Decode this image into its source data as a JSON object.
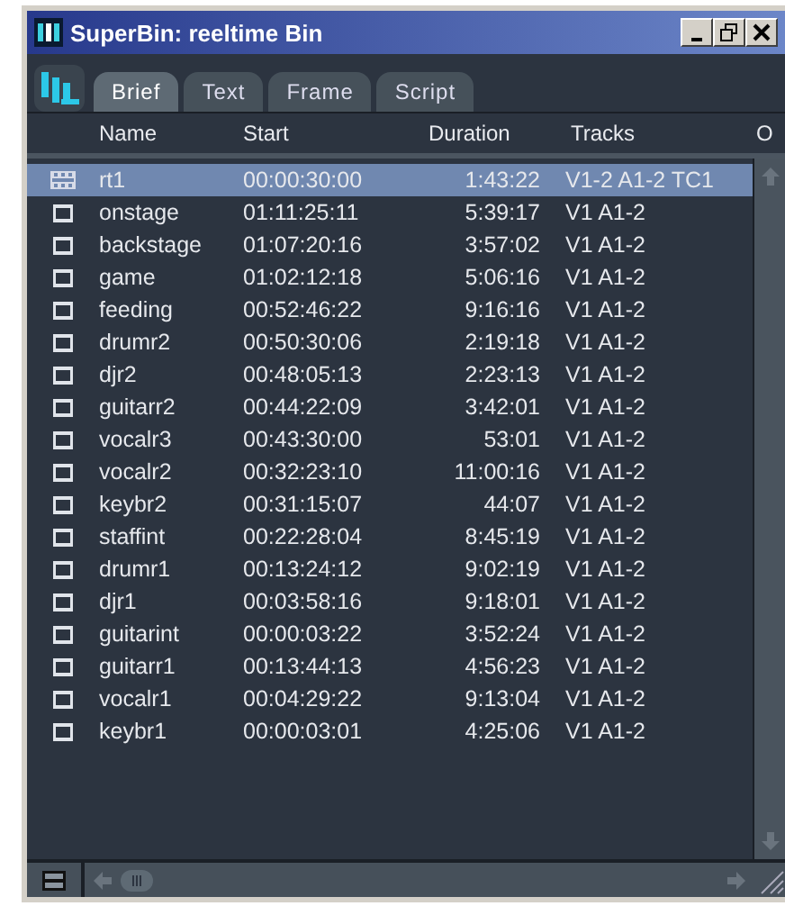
{
  "window": {
    "title": "SuperBin: reeltime Bin"
  },
  "tabs": [
    {
      "label": "Brief",
      "selected": true
    },
    {
      "label": "Text",
      "selected": false
    },
    {
      "label": "Frame",
      "selected": false
    },
    {
      "label": "Script",
      "selected": false
    }
  ],
  "columns": [
    "Name",
    "Start",
    "Duration",
    "Tracks",
    "O"
  ],
  "rows": [
    {
      "kind": "sequence",
      "selected": true,
      "name": "rt1",
      "start": "00:00:30:00",
      "duration": "1:43:22",
      "tracks": "V1-2 A1-2 TC1"
    },
    {
      "kind": "clip",
      "selected": false,
      "name": "onstage",
      "start": "01:11:25:11",
      "duration": "5:39:17",
      "tracks": "V1 A1-2"
    },
    {
      "kind": "clip",
      "selected": false,
      "name": "backstage",
      "start": "01:07:20:16",
      "duration": "3:57:02",
      "tracks": "V1 A1-2"
    },
    {
      "kind": "clip",
      "selected": false,
      "name": "game",
      "start": "01:02:12:18",
      "duration": "5:06:16",
      "tracks": "V1 A1-2"
    },
    {
      "kind": "clip",
      "selected": false,
      "name": "feeding",
      "start": "00:52:46:22",
      "duration": "9:16:16",
      "tracks": "V1 A1-2"
    },
    {
      "kind": "clip",
      "selected": false,
      "name": "drumr2",
      "start": "00:50:30:06",
      "duration": "2:19:18",
      "tracks": "V1 A1-2"
    },
    {
      "kind": "clip",
      "selected": false,
      "name": "djr2",
      "start": "00:48:05:13",
      "duration": "2:23:13",
      "tracks": "V1 A1-2"
    },
    {
      "kind": "clip",
      "selected": false,
      "name": "guitarr2",
      "start": "00:44:22:09",
      "duration": "3:42:01",
      "tracks": "V1 A1-2"
    },
    {
      "kind": "clip",
      "selected": false,
      "name": "vocalr3",
      "start": "00:43:30:00",
      "duration": "53:01",
      "tracks": "V1 A1-2"
    },
    {
      "kind": "clip",
      "selected": false,
      "name": "vocalr2",
      "start": "00:32:23:10",
      "duration": "11:00:16",
      "tracks": "V1 A1-2"
    },
    {
      "kind": "clip",
      "selected": false,
      "name": "keybr2",
      "start": "00:31:15:07",
      "duration": "44:07",
      "tracks": "V1 A1-2"
    },
    {
      "kind": "clip",
      "selected": false,
      "name": "staffint",
      "start": "00:22:28:04",
      "duration": "8:45:19",
      "tracks": "V1 A1-2"
    },
    {
      "kind": "clip",
      "selected": false,
      "name": "drumr1",
      "start": "00:13:24:12",
      "duration": "9:02:19",
      "tracks": "V1 A1-2"
    },
    {
      "kind": "clip",
      "selected": false,
      "name": "djr1",
      "start": "00:03:58:16",
      "duration": "9:18:01",
      "tracks": "V1 A1-2"
    },
    {
      "kind": "clip",
      "selected": false,
      "name": "guitarint",
      "start": "00:00:03:22",
      "duration": "3:52:24",
      "tracks": "V1 A1-2"
    },
    {
      "kind": "clip",
      "selected": false,
      "name": "guitarr1",
      "start": "00:13:44:13",
      "duration": "4:56:23",
      "tracks": "V1 A1-2"
    },
    {
      "kind": "clip",
      "selected": false,
      "name": "vocalr1",
      "start": "00:04:29:22",
      "duration": "9:13:04",
      "tracks": "V1 A1-2"
    },
    {
      "kind": "clip",
      "selected": false,
      "name": "keybr1",
      "start": "00:00:03:01",
      "duration": "4:25:06",
      "tracks": "V1 A1-2"
    }
  ]
}
